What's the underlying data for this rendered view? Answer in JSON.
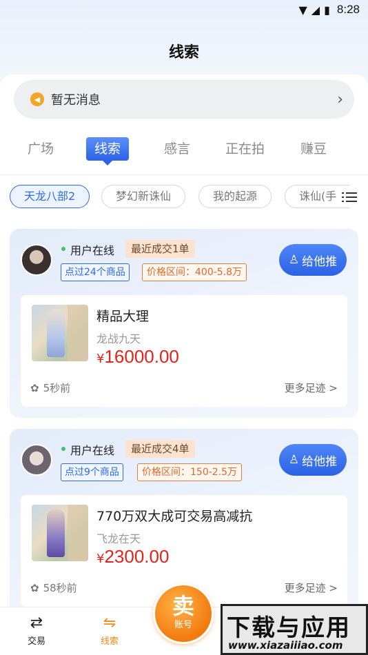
{
  "status_bar": {
    "time": "8:28"
  },
  "header": {
    "title": "线索"
  },
  "notice": {
    "text": "暂无消息"
  },
  "tabs": [
    {
      "label": "广场"
    },
    {
      "label": "线索",
      "active": true
    },
    {
      "label": "感言"
    },
    {
      "label": "正在拍"
    },
    {
      "label": "赚豆"
    }
  ],
  "games": [
    {
      "label": "天龙八部2",
      "active": true
    },
    {
      "label": "梦幻新诛仙"
    },
    {
      "label": "我的起源"
    },
    {
      "label": "诛仙(手"
    }
  ],
  "cards": [
    {
      "online": "用户在线",
      "recent_deals": "最近成交1单",
      "viewed": "点过24个商品",
      "price_range": "价格区间：400-5.8万",
      "push_label": "给他推",
      "product": {
        "title": "精品大理",
        "server": "龙战九天",
        "currency": "¥",
        "price": "16000.00"
      },
      "time": "5秒前",
      "more": "更多足迹 >"
    },
    {
      "online": "用户在线",
      "recent_deals": "最近成交4单",
      "viewed": "点过9个商品",
      "price_range": "价格区间：150-2.5万",
      "push_label": "给他推",
      "product": {
        "title": "770万双大成可交易高减抗",
        "server": "飞龙在天",
        "currency": "¥",
        "price": "2300.00"
      },
      "time": "58秒前",
      "more": "更多足迹 >"
    }
  ],
  "bottom_nav": {
    "trade": "交易",
    "clues": "线索",
    "sell_big": "卖",
    "sell_small": "账号"
  },
  "watermark": {
    "big": "下载与应用",
    "url": "www.xiazaiiiao.com"
  },
  "colors": {
    "primary": "#2d6be6",
    "accent": "#f08a1c",
    "price": "#e3231a"
  }
}
